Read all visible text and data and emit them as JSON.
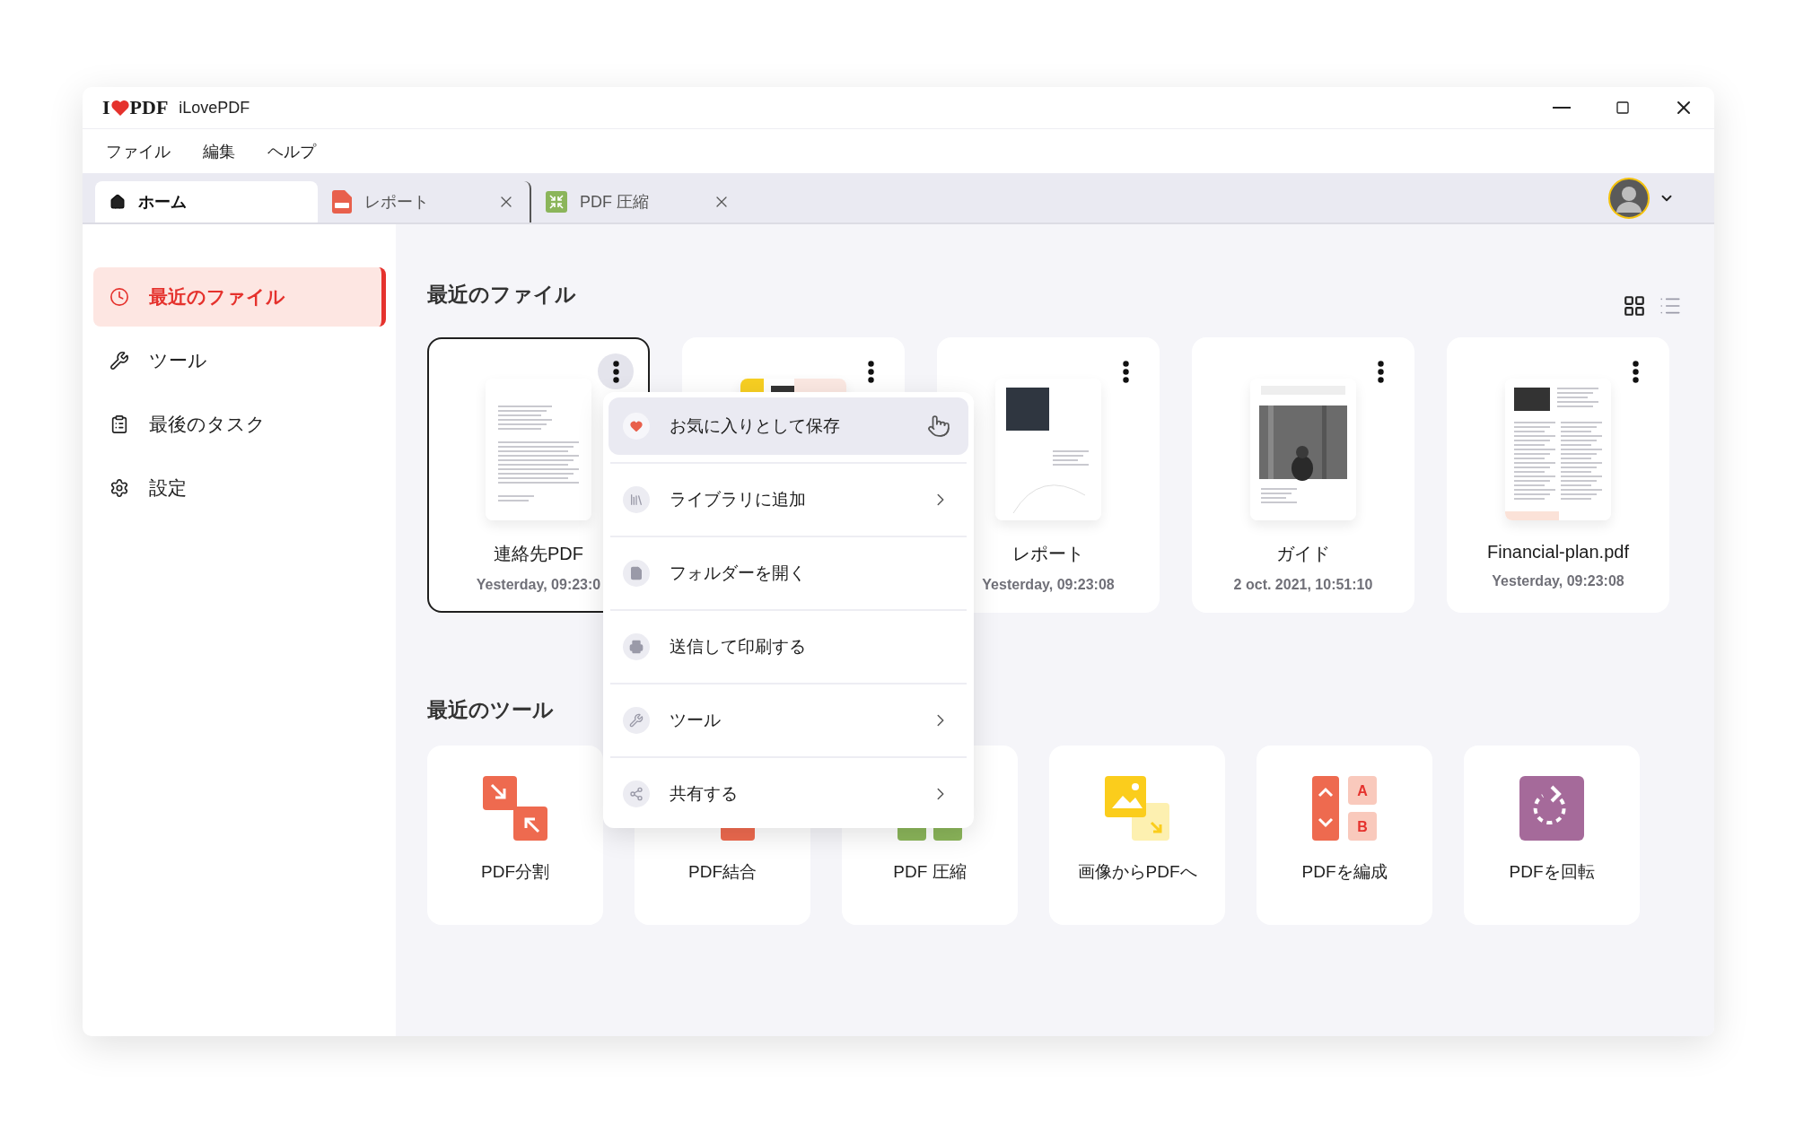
{
  "window": {
    "logo": [
      "I",
      "PDF"
    ],
    "title": "iLovePDF"
  },
  "menu_bar": [
    "ファイル",
    "編集",
    "ヘルプ"
  ],
  "tabs": [
    {
      "label": "ホーム",
      "kind": "home",
      "selected": true,
      "closable": false
    },
    {
      "label": "レポート",
      "kind": "pdf",
      "selected": false,
      "closable": true
    },
    {
      "label": "PDF 圧縮",
      "kind": "compress",
      "selected": false,
      "closable": true
    }
  ],
  "sidebar": {
    "items": [
      {
        "label": "最近のファイル",
        "selected": true
      },
      {
        "label": "ツール",
        "selected": false
      },
      {
        "label": "最後のタスク",
        "selected": false
      },
      {
        "label": "設定",
        "selected": false
      }
    ]
  },
  "recent_files": {
    "title": "最近のファイル",
    "views": [
      {
        "kind": "grid",
        "selected": true
      },
      {
        "kind": "list",
        "selected": false
      }
    ],
    "files": [
      {
        "name": "連絡先PDF",
        "date": "Yesterday, 09:23:0",
        "selected": true,
        "menu_open": true
      },
      {
        "selected": false,
        "menu_open": false
      },
      {
        "name": "レポート",
        "date": "Yesterday, 09:23:08",
        "selected": false,
        "menu_open": false
      },
      {
        "name": "ガイド",
        "date": "2 oct. 2021, 10:51:10",
        "selected": false,
        "menu_open": false
      },
      {
        "name": "Financial-plan.pdf",
        "date": "Yesterday, 09:23:08",
        "selected": false,
        "menu_open": false
      }
    ]
  },
  "context_menu": {
    "items": [
      {
        "label": "お気に入りとして保存",
        "highlighted": true,
        "submenu": false
      },
      {
        "label": "ライブラリに追加",
        "highlighted": false,
        "submenu": true
      },
      {
        "label": "フォルダーを開く",
        "highlighted": false,
        "submenu": false
      },
      {
        "label": "送信して印刷する",
        "highlighted": false,
        "submenu": false
      },
      {
        "label": "ツール",
        "highlighted": false,
        "submenu": true
      },
      {
        "label": "共有する",
        "highlighted": false,
        "submenu": true
      }
    ]
  },
  "recent_tools": {
    "title": "最近のツール",
    "tools": [
      {
        "label": "PDF分割",
        "kind": "split"
      },
      {
        "label": "PDF結合",
        "kind": "merge"
      },
      {
        "label": "PDF 圧縮",
        "kind": "compress"
      },
      {
        "label": "画像からPDFへ"
      },
      {
        "label": "PDFを編成",
        "kind": "organize",
        "marks": [
          "A",
          "B"
        ]
      },
      {
        "label": "PDFを回転",
        "kind": "rotate"
      }
    ]
  }
}
